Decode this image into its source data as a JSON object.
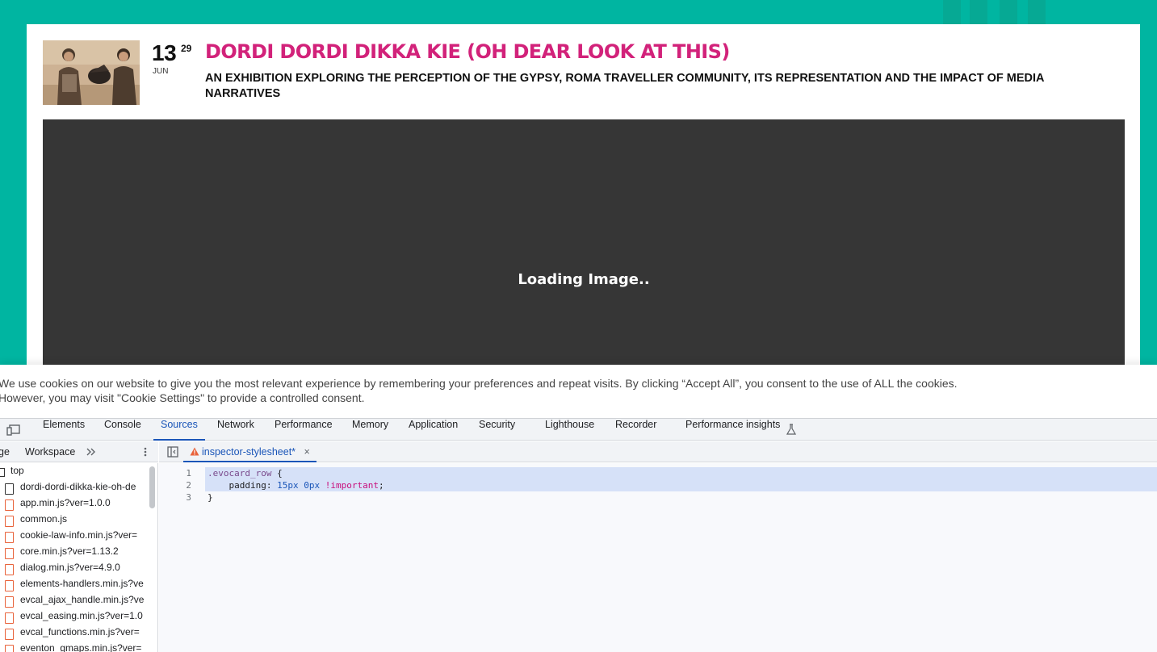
{
  "event": {
    "day": "13",
    "end_day": "29",
    "month": "JUN",
    "title": "DORDI DORDI DIKKA KIE (OH DEAR LOOK AT THIS)",
    "subtitle": "AN EXHIBITION EXPLORING THE PERCEPTION OF THE GYPSY, ROMA TRAVELLER COMMUNITY, ITS REPRESENTATION AND THE IMPACT OF MEDIA NARRATIVES",
    "loading_text": "Loading Image..",
    "title_color": "#d2227a",
    "background_color": "#00b5a1"
  },
  "cookie_banner": {
    "text_line1": "We use cookies on our website to give you the most relevant experience by remembering your preferences and repeat visits. By clicking “Accept All”, you consent to the use of ALL the cookies.",
    "text_line2": "However, you may visit \"Cookie Settings\" to provide a controlled consent."
  },
  "devtools": {
    "tabs": [
      "Elements",
      "Console",
      "Sources",
      "Network",
      "Performance",
      "Memory",
      "Application",
      "Security",
      "Lighthouse",
      "Recorder",
      "Performance insights"
    ],
    "active_tab": "Sources",
    "navigator": {
      "tab_partial": "ge",
      "workspace_label": "Workspace",
      "more_icon": "chevron-double-right-icon",
      "tree_root": "top",
      "files": [
        "dordi-dordi-dikka-kie-oh-de",
        "app.min.js?ver=1.0.0",
        "common.js",
        "cookie-law-info.min.js?ver=",
        "core.min.js?ver=1.13.2",
        "dialog.min.js?ver=4.9.0",
        "elements-handlers.min.js?ve",
        "evcal_ajax_handle.min.js?ve",
        "evcal_easing.min.js?ver=1.0",
        "evcal_functions.min.js?ver=",
        "eventon_gmaps.min.js?ver="
      ]
    },
    "editor": {
      "tab_label": "inspector-stylesheet*",
      "line_numbers": [
        "1",
        "2",
        "3"
      ],
      "code": {
        "selector": ".evocard_row",
        "open_brace": " {",
        "property": "padding",
        "value_1": "15px",
        "value_2": "0px",
        "important": "!important",
        "close_brace": "}"
      }
    }
  }
}
